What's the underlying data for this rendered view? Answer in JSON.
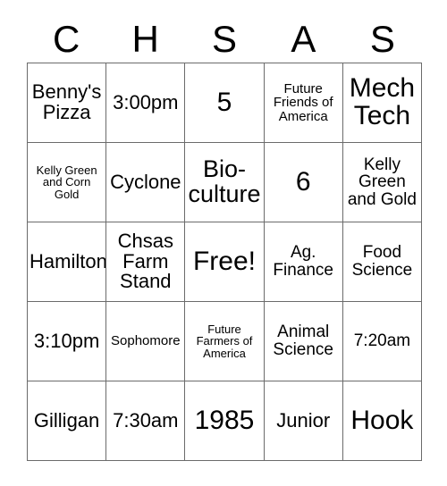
{
  "card": {
    "headers": [
      "C",
      "H",
      "S",
      "A",
      "S"
    ],
    "rows": [
      [
        {
          "text": "Benny's Pizza",
          "size": "lg"
        },
        {
          "text": "3:00pm",
          "size": "lg"
        },
        {
          "text": "5",
          "size": "xxl"
        },
        {
          "text": "Future Friends of America",
          "size": "sm"
        },
        {
          "text": "Mech Tech",
          "size": "xxl"
        }
      ],
      [
        {
          "text": "Kelly Green and Corn Gold",
          "size": "xs"
        },
        {
          "text": "Cyclone",
          "size": "lg"
        },
        {
          "text": "Bio-culture",
          "size": "xl"
        },
        {
          "text": "6",
          "size": "xxl"
        },
        {
          "text": "Kelly Green and Gold",
          "size": "md"
        }
      ],
      [
        {
          "text": "Hamilton",
          "size": "lg"
        },
        {
          "text": "Chsas Farm Stand",
          "size": "lg"
        },
        {
          "text": "Free!",
          "size": "xxl"
        },
        {
          "text": "Ag. Finance",
          "size": "md"
        },
        {
          "text": "Food Science",
          "size": "md"
        }
      ],
      [
        {
          "text": "3:10pm",
          "size": "lg"
        },
        {
          "text": "Sophomore",
          "size": "sm"
        },
        {
          "text": "Future Farmers of America",
          "size": "xs"
        },
        {
          "text": "Animal Science",
          "size": "md"
        },
        {
          "text": "7:20am",
          "size": "md"
        }
      ],
      [
        {
          "text": "Gilligan",
          "size": "lg"
        },
        {
          "text": "7:30am",
          "size": "lg"
        },
        {
          "text": "1985",
          "size": "xxl"
        },
        {
          "text": "Junior",
          "size": "lg"
        },
        {
          "text": "Hook",
          "size": "xxl"
        }
      ]
    ]
  },
  "colors": {
    "background": "#ffffff",
    "text": "#000000",
    "gridline": "#6b6b6b"
  }
}
